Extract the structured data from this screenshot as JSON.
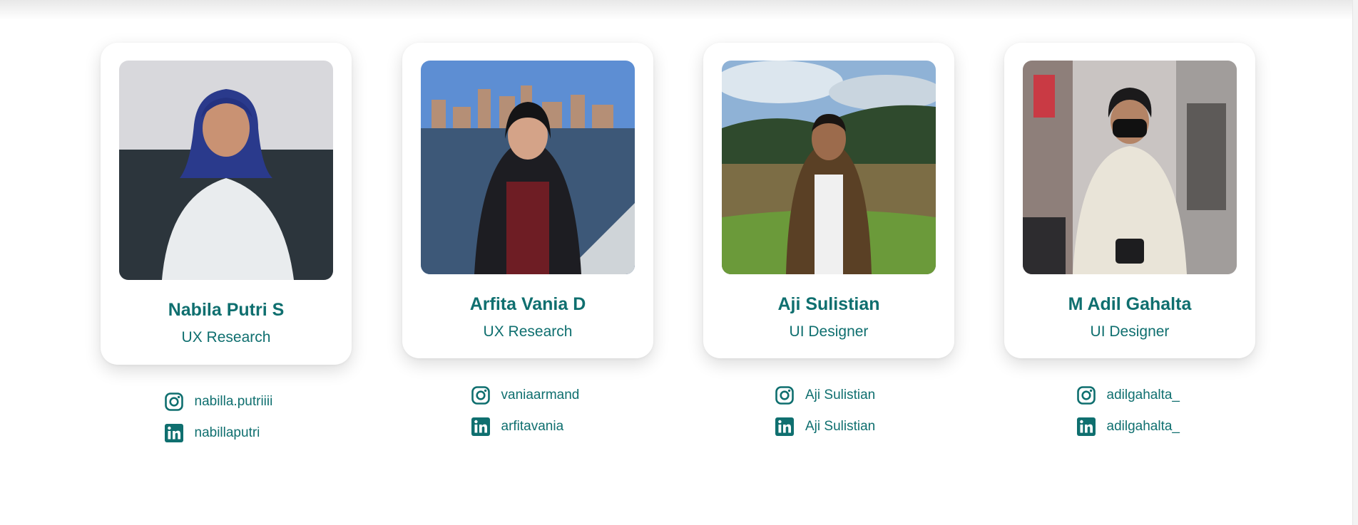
{
  "accent_color": "#0f6f6f",
  "team": [
    {
      "name": "Nabila Putri S",
      "role": "UX Research",
      "photo_icon": "person-photo",
      "instagram": "nabilla.putriiii",
      "linkedin": "nabillaputri"
    },
    {
      "name": "Arfita Vania D",
      "role": "UX Research",
      "photo_icon": "person-photo",
      "instagram": "vaniaarmand",
      "linkedin": "arfitavania"
    },
    {
      "name": "Aji Sulistian",
      "role": "UI Designer",
      "photo_icon": "person-photo",
      "instagram": "Aji Sulistian",
      "linkedin": "Aji Sulistian"
    },
    {
      "name": "M Adil Gahalta",
      "role": "UI Designer",
      "photo_icon": "person-photo",
      "instagram": "adilgahalta_",
      "linkedin": "adilgahalta_"
    }
  ]
}
